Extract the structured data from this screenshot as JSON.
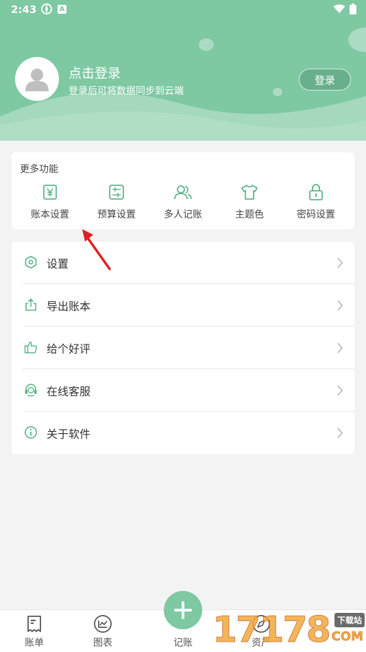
{
  "status_bar": {
    "time": "2:43",
    "notification_badge": "A"
  },
  "header": {
    "login_title": "点击登录",
    "login_subtitle": "登录后可将数据同步到云端",
    "login_button": "登录"
  },
  "features": {
    "title": "更多功能",
    "items": [
      {
        "label": "账本设置",
        "icon": "yen-ledger-icon"
      },
      {
        "label": "预算设置",
        "icon": "budget-icon"
      },
      {
        "label": "多人记账",
        "icon": "users-icon"
      },
      {
        "label": "主题色",
        "icon": "shirt-icon"
      },
      {
        "label": "密码设置",
        "icon": "lock-icon"
      }
    ]
  },
  "menu": {
    "items": [
      {
        "label": "设置",
        "icon": "hex-gear-icon"
      },
      {
        "label": "导出账本",
        "icon": "share-export-icon"
      },
      {
        "label": "给个好评",
        "icon": "thumbs-up-icon"
      },
      {
        "label": "在线客服",
        "icon": "headset-icon"
      },
      {
        "label": "关于软件",
        "icon": "info-icon"
      }
    ]
  },
  "tabbar": {
    "items": [
      {
        "label": "账单",
        "icon": "receipt-icon"
      },
      {
        "label": "图表",
        "icon": "chart-icon"
      },
      {
        "label": "记账",
        "icon": "plus-icon"
      },
      {
        "label": "资产",
        "icon": "compass-icon"
      }
    ]
  },
  "watermark": {
    "digits": "17178",
    "badge": "下载站",
    "suffix": "COM"
  },
  "colors": {
    "accent": "#7ec8a2",
    "icon_green": "#5bb58a",
    "background": "#f3f3f3"
  }
}
